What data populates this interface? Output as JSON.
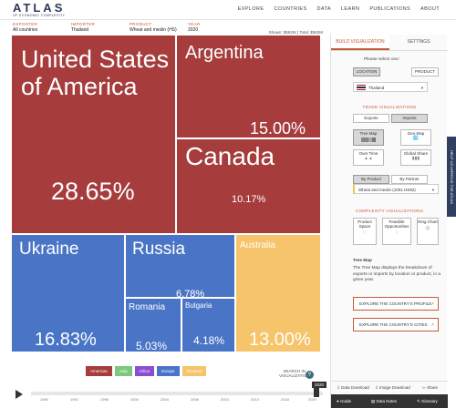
{
  "header": {
    "logo": "ATLAS",
    "logo_sub": "OF ECONOMIC COMPLEXITY",
    "nav": [
      "EXPLORE",
      "COUNTRIES",
      "DATA",
      "LEARN",
      "PUBLICATIONS",
      "ABOUT"
    ]
  },
  "filters": {
    "exporter_label": "EXPORTER",
    "exporter_value": "All countries",
    "importer_label": "IMPORTER",
    "importer_value": "Thailand",
    "product_label": "PRODUCT",
    "product_value": "Wheat and meslin (HS)",
    "year_label": "YEAR",
    "year_value": "2020",
    "share_text": "Shown: $582M | Total: $582M"
  },
  "treemap": [
    {
      "name": "United States of America",
      "pct": "28.65%",
      "region": "Americas"
    },
    {
      "name": "Argentina",
      "pct": "15.00%",
      "region": "Americas"
    },
    {
      "name": "Canada",
      "pct": "10.17%",
      "region": "Americas"
    },
    {
      "name": "Ukraine",
      "pct": "16.83%",
      "region": "Europe"
    },
    {
      "name": "Russia",
      "pct": "6.78%",
      "region": "Europe"
    },
    {
      "name": "Romania",
      "pct": "5.03%",
      "region": "Europe"
    },
    {
      "name": "Bulgaria",
      "pct": "4.18%",
      "region": "Europe"
    },
    {
      "name": "Australia",
      "pct": "13.00%",
      "region": "Oceania"
    }
  ],
  "legend": [
    {
      "label": "Americas",
      "color": "#a63c3c"
    },
    {
      "label": "Asia",
      "color": "#7ec87e"
    },
    {
      "label": "Africa",
      "color": "#8a4fd1"
    },
    {
      "label": "Europe",
      "color": "#4a75c7"
    },
    {
      "label": "Oceania",
      "color": "#f5c46b"
    }
  ],
  "controls": {
    "search_line1": "SEARCH IN",
    "search_line2": "VISUALIZATION",
    "year_badge": "2020",
    "ticks": [
      "1990",
      "1992",
      "1996",
      "2000",
      "2004",
      "2006",
      "2010",
      "2014",
      "2018",
      "2020"
    ]
  },
  "panel": {
    "tab_build": "BUILD VISUALIZATION",
    "tab_settings": "SETTINGS",
    "please_select": "Please select one:",
    "location_btn": "LOCATION",
    "product_btn": "PRODUCT",
    "location_value": "Thailand",
    "trade_title": "TRADE VISUALIZATIONS",
    "exports": "Exports",
    "imports": "Imports",
    "tree_map": "Tree Map",
    "geo_map": "Geo Map",
    "over_time": "Over Time",
    "global_share": "Global Share",
    "by_product": "By Product",
    "by_partner": "By Partner",
    "product_dropdown": "Wheat and meslin (1001 HS92)",
    "complexity_title": "COMPLEXITY VISUALIZATIONS",
    "product_space": "Product Space",
    "feasible": "Feasible Opportunities",
    "ring_chart": "Ring Chart",
    "desc_title": "Tree Map",
    "desc_text": "The Tree Map displays the breakdown of exports or imports by location or product, in a given year.",
    "explore_profile": "EXPLORE THE COUNTRY'S PROFILE",
    "explore_cities": "EXPLORE THE COUNTRY'S CITIES",
    "data_download": "Data Download",
    "image_download": "Image Download",
    "share": "Share",
    "guide": "Guide",
    "data_notes": "Data Notes",
    "glossary": "Glossary",
    "side_tab": "HELP US IMPROVE THE ATLAS"
  }
}
